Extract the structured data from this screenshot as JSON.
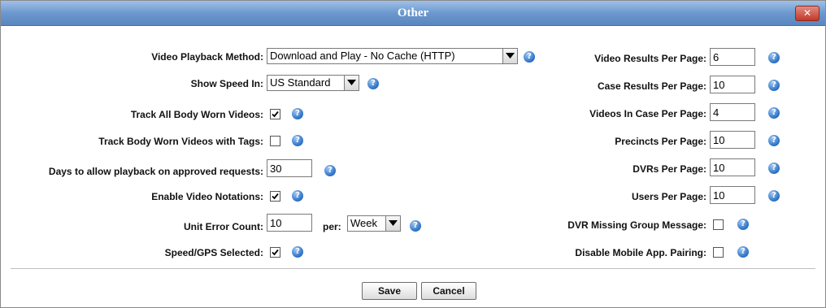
{
  "dialog": {
    "title": "Other",
    "close_label": "✕"
  },
  "left": {
    "video_playback": {
      "label": "Video Playback Method:",
      "value": "Download and Play - No Cache (HTTP)"
    },
    "show_speed": {
      "label": "Show Speed In:",
      "value": "US Standard"
    },
    "track_all_bwv": {
      "label": "Track All Body Worn Videos:",
      "checked": true
    },
    "track_bwv_tags": {
      "label": "Track Body Worn Videos with Tags:",
      "checked": false
    },
    "days_playback": {
      "label": "Days to allow playback on approved requests:",
      "value": "30"
    },
    "video_notations": {
      "label": "Enable Video Notations:",
      "checked": true
    },
    "unit_error": {
      "label": "Unit Error Count:",
      "value": "10",
      "per_label": "per:",
      "per_value": "Week"
    },
    "speed_gps": {
      "label": "Speed/GPS Selected:",
      "checked": true
    }
  },
  "right": {
    "video_results": {
      "label": "Video Results Per Page:",
      "value": "6"
    },
    "case_results": {
      "label": "Case Results Per Page:",
      "value": "10"
    },
    "videos_in_case": {
      "label": "Videos In Case Per Page:",
      "value": "4"
    },
    "precincts": {
      "label": "Precincts Per Page:",
      "value": "10"
    },
    "dvrs": {
      "label": "DVRs Per Page:",
      "value": "10"
    },
    "users": {
      "label": "Users Per Page:",
      "value": "10"
    },
    "dvr_missing": {
      "label": "DVR Missing Group Message:",
      "checked": false
    },
    "disable_mobile": {
      "label": "Disable Mobile App. Pairing:",
      "checked": false
    }
  },
  "buttons": {
    "save": "Save",
    "cancel": "Cancel"
  },
  "help_glyph": "?",
  "colors": {
    "titlebar": "#6c98cf",
    "help": "#2a6fc4",
    "close": "#c0392b"
  }
}
